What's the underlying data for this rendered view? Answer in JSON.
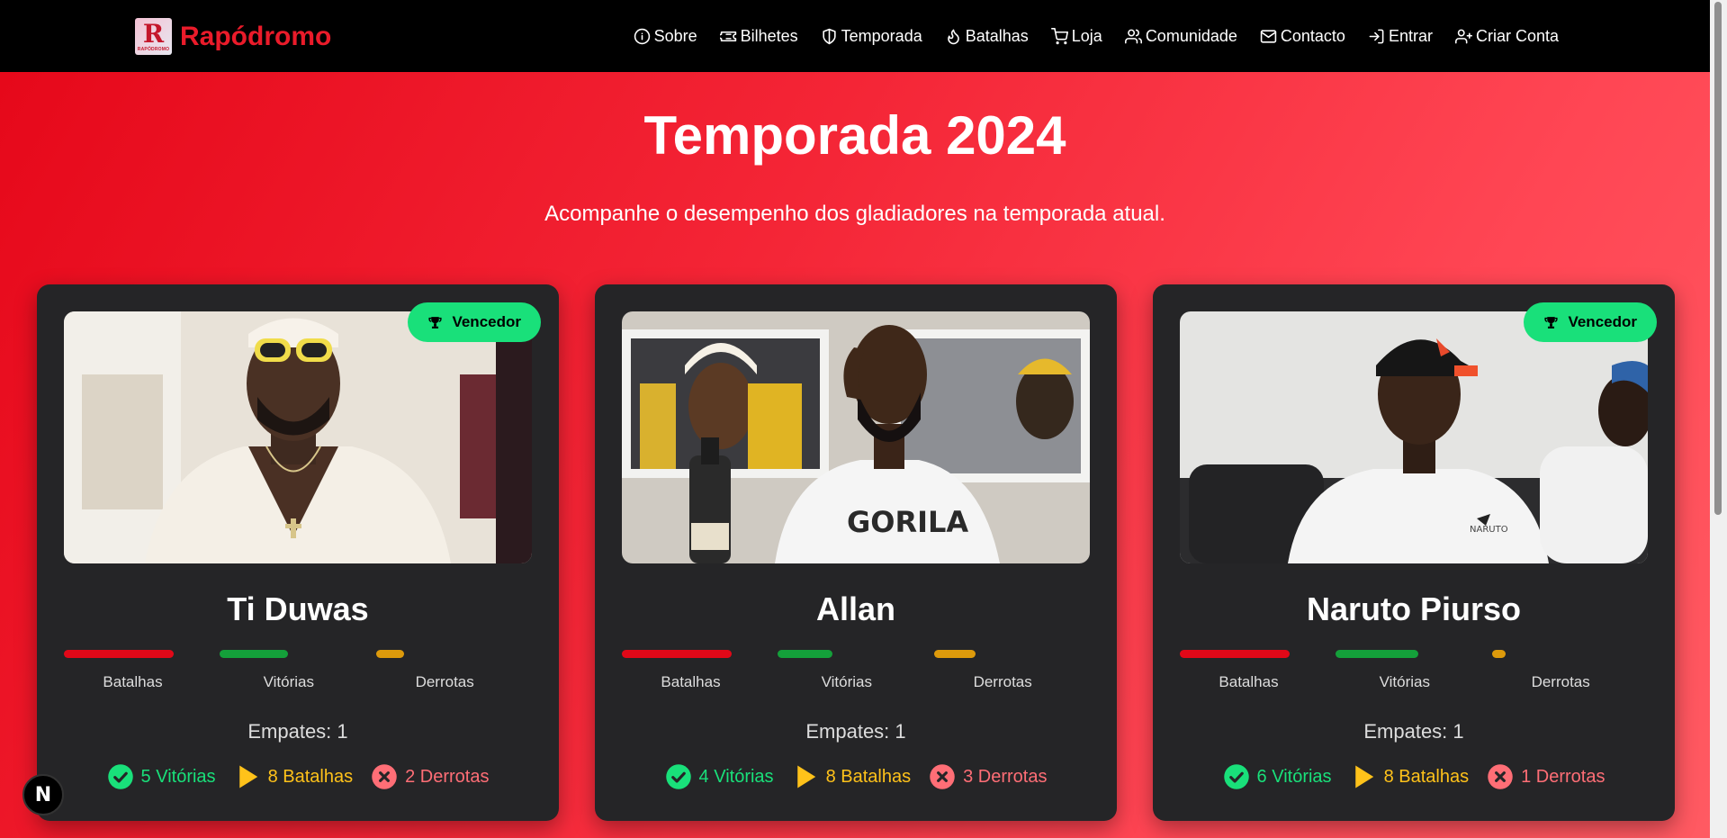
{
  "brand": {
    "name": "Rapódromo",
    "logo_letter": "R",
    "logo_text": "RAPÓDROMO"
  },
  "nav": [
    {
      "label": "Sobre",
      "icon": "info-icon"
    },
    {
      "label": "Bilhetes",
      "icon": "ticket-icon"
    },
    {
      "label": "Temporada",
      "icon": "shield-icon"
    },
    {
      "label": "Batalhas",
      "icon": "flame-icon"
    },
    {
      "label": "Loja",
      "icon": "cart-icon"
    },
    {
      "label": "Comunidade",
      "icon": "users-icon"
    },
    {
      "label": "Contacto",
      "icon": "mail-icon"
    },
    {
      "label": "Entrar",
      "icon": "login-icon"
    },
    {
      "label": "Criar Conta",
      "icon": "user-plus-icon"
    }
  ],
  "hero": {
    "title": "Temporada 2024",
    "subtitle": "Acompanhe o desempenho dos gladiadores na temporada atual."
  },
  "colors": {
    "battles_bar": "#e10818",
    "wins_bar": "#14a03a",
    "losses_bar": "#dd9a0b",
    "badge": "#19e07a"
  },
  "labels": {
    "battles": "Batalhas",
    "wins": "Vitórias",
    "losses": "Derrotas",
    "winner": "Vencedor"
  },
  "cards": [
    {
      "name": "Ti Duwas",
      "winner": true,
      "bars": {
        "battles": 1.0,
        "wins": 0.625,
        "losses": 0.25
      },
      "empates": "Empates: 1",
      "wins_text": "5 Vitórias",
      "battles_text": "8 Batalhas",
      "losses_text": "2 Derrotas"
    },
    {
      "name": "Allan",
      "winner": false,
      "bars": {
        "battles": 1.0,
        "wins": 0.5,
        "losses": 0.375
      },
      "empates": "Empates: 1",
      "wins_text": "4 Vitórias",
      "battles_text": "8 Batalhas",
      "losses_text": "3 Derrotas"
    },
    {
      "name": "Naruto Piurso",
      "winner": true,
      "bars": {
        "battles": 1.0,
        "wins": 0.75,
        "losses": 0.125
      },
      "empates": "Empates: 1",
      "wins_text": "6 Vitórias",
      "battles_text": "8 Batalhas",
      "losses_text": "1 Derrotas"
    }
  ],
  "floating_button": "N"
}
